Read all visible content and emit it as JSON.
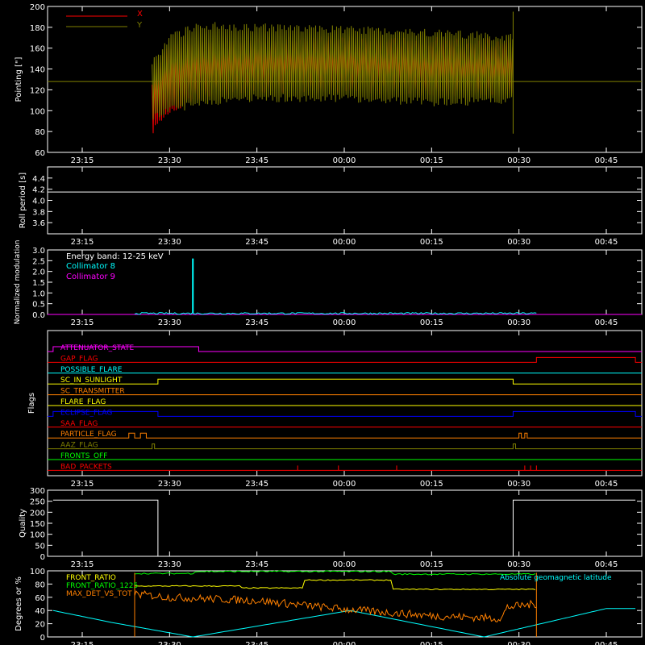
{
  "time_ticks": [
    "23:15",
    "23:30",
    "23:45",
    "00:00",
    "00:15",
    "00:30",
    "00:45"
  ],
  "colors": {
    "axis": "#ffffff",
    "x_pointing": "#ff0000",
    "y_pointing": "#808000",
    "roll": "#ffffff",
    "c8": "#00ffff",
    "c9": "#ff00ff",
    "quality": "#ffffff",
    "front_ratio": "#ffff00",
    "front_ratio_1225": "#00ff00",
    "max_det_vs_tot": "#ff8000",
    "geomag": "#00ffff"
  },
  "chart_data": [
    {
      "type": "line",
      "ylabel": "Pointing [\"]",
      "ylim": [
        60,
        200
      ],
      "yticks": [
        "60",
        "80",
        "100",
        "120",
        "140",
        "160",
        "180",
        "200"
      ],
      "legend": [
        "X",
        "Y"
      ],
      "series": [
        {
          "name": "X",
          "x": [
            "23:27",
            "23:30",
            "23:35",
            "23:45",
            "00:00",
            "00:15",
            "00:29"
          ],
          "upper": [
            130,
            160,
            162,
            165,
            167,
            166,
            165
          ],
          "lower": [
            80,
            100,
            115,
            122,
            122,
            118,
            120
          ]
        },
        {
          "name": "Y",
          "x": [
            "23:27",
            "23:30",
            "23:35",
            "23:45",
            "00:00",
            "00:15",
            "00:29"
          ],
          "upper": [
            145,
            170,
            182,
            180,
            178,
            175,
            170
          ],
          "lower": [
            95,
            100,
            108,
            112,
            112,
            108,
            110
          ],
          "flat_level": 128
        }
      ]
    },
    {
      "type": "line",
      "ylabel": "Roll period [s]",
      "ylim": [
        3.4,
        4.6
      ],
      "yticks": [
        "3.6",
        "3.8",
        "4.0",
        "4.2",
        "4.4"
      ],
      "series": [
        {
          "name": "",
          "x": [
            "23:10",
            "00:50"
          ],
          "values": [
            4.15,
            4.15
          ]
        }
      ]
    },
    {
      "type": "line",
      "ylabel": "Normalized modulation",
      "ylim": [
        0,
        3.0
      ],
      "yticks": [
        "0.0",
        "0.5",
        "1.0",
        "1.5",
        "2.0",
        "2.5",
        "3.0"
      ],
      "legend": [
        "Energy band: 12-25 keV",
        "Collimator 8",
        "Collimator 9"
      ],
      "series": [
        {
          "name": "Collimator 8",
          "x": [
            "23:24",
            "00:33"
          ],
          "baseline": 0.05,
          "spike_time": "23:34",
          "spike_value": 2.6
        },
        {
          "name": "Collimator 9",
          "x": [
            "23:10",
            "00:50"
          ],
          "values": [
            0.0,
            0.0
          ]
        }
      ]
    },
    {
      "type": "line",
      "ylabel": "Flags",
      "flags": [
        {
          "name": "ATTENUATOR_STATE",
          "color": "#ff00ff",
          "high": [
            [
              "23:10",
              "23:35"
            ]
          ]
        },
        {
          "name": "GAP_FLAG",
          "color": "#ff0000",
          "high": [
            [
              "00:33",
              "00:50"
            ]
          ]
        },
        {
          "name": "POSSIBLE_FLARE",
          "color": "#00ffff",
          "high": []
        },
        {
          "name": "SC_IN_SUNLIGHT",
          "color": "#ffff00",
          "high": [
            [
              "23:28",
              "00:29"
            ]
          ]
        },
        {
          "name": "SC_TRANSMITTER",
          "color": "#ff8000",
          "high": []
        },
        {
          "name": "FLARE_FLAG",
          "color": "#ffff00",
          "high": []
        },
        {
          "name": "ECLIPSE_FLAG",
          "color": "#0000ff",
          "high": [
            [
              "23:10",
              "23:28"
            ],
            [
              "00:29",
              "00:50"
            ]
          ]
        },
        {
          "name": "SAA_FLAG",
          "color": "#ff0000",
          "high": []
        },
        {
          "name": "PARTICLE_FLAG",
          "color": "#ff8000",
          "high": [
            [
              "23:23",
              "23:24"
            ],
            [
              "23:25",
              "23:26"
            ],
            [
              "00:30",
              "00:30"
            ],
            [
              "00:31",
              "00:31"
            ]
          ]
        },
        {
          "name": "AAZ_FLAG",
          "color": "#808000",
          "high": [
            [
              "23:27",
              "23:27"
            ],
            [
              "00:29",
              "00:29"
            ]
          ]
        },
        {
          "name": "FRONTS_OFF",
          "color": "#00ff00",
          "high": []
        },
        {
          "name": "BAD_PACKETS",
          "color": "#ff0000",
          "spikes": [
            "23:52",
            "23:59",
            "00:09",
            "00:31",
            "00:32",
            "00:33"
          ]
        }
      ]
    },
    {
      "type": "line",
      "ylabel": "Quality",
      "ylim": [
        0,
        300
      ],
      "yticks": [
        "0",
        "50",
        "100",
        "150",
        "200",
        "250",
        "300"
      ],
      "series": [
        {
          "name": "",
          "segments": [
            {
              "x": [
                "23:10",
                "23:28"
              ],
              "value": 255
            },
            {
              "x": [
                "00:29",
                "00:50"
              ],
              "value": 255
            }
          ]
        }
      ]
    },
    {
      "type": "line",
      "ylabel": "Degrees or %",
      "ylim": [
        0,
        100
      ],
      "yticks": [
        "0",
        "20",
        "40",
        "60",
        "80",
        "100"
      ],
      "legend": [
        "FRONT_RATIO",
        "FRONT_RATIO_1225",
        "MAX_DET_VS_TOT",
        "Absolute geomagnetic latitude"
      ],
      "series": [
        {
          "name": "FRONT_RATIO",
          "steps": [
            [
              "23:24",
              77
            ],
            [
              "23:42",
              74
            ],
            [
              "23:53",
              86
            ],
            [
              "00:08",
              72
            ],
            [
              "00:33",
              72
            ]
          ]
        },
        {
          "name": "FRONT_RATIO_1225",
          "steps": [
            [
              "23:24",
              96
            ],
            [
              "23:34",
              99
            ],
            [
              "00:08",
              95
            ],
            [
              "00:33",
              95
            ]
          ]
        },
        {
          "name": "MAX_DET_VS_TOT",
          "x": [
            "23:24",
            "23:30",
            "23:45",
            "00:00",
            "00:15",
            "00:27",
            "00:28",
            "00:33"
          ],
          "values": [
            65,
            60,
            55,
            42,
            32,
            28,
            45,
            50
          ]
        },
        {
          "name": "Absolute geomagnetic latitude",
          "x": [
            "23:10",
            "23:20",
            "23:34",
            "00:01",
            "00:24",
            "00:45",
            "00:50"
          ],
          "values": [
            40,
            22,
            0,
            40,
            0,
            43,
            43
          ]
        }
      ]
    }
  ]
}
